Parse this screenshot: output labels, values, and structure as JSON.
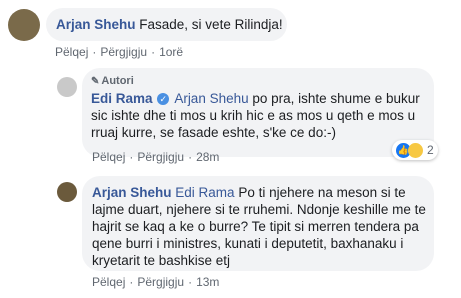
{
  "comment1": {
    "author": "Arjan Shehu",
    "text": "Fasade, si vete Rilindja!",
    "like": "Pëlqej",
    "reply": "Përgjigju",
    "time": "1orë"
  },
  "comment2": {
    "badge": "Autori",
    "author": "Edi Rama",
    "mention": "Arjan Shehu",
    "line1": " po pra, ishte shume e bukur",
    "line2": "sic ishte dhe ti mos u krih hic e as mos u qeth e mos u",
    "line3": "rruaj kurre, se fasade eshte, s'ke ce do:-)",
    "like": "Pëlqej",
    "reply": "Përgjigju",
    "time": "28m",
    "reaction_count": "2"
  },
  "comment3": {
    "author": "Arjan Shehu",
    "mention": "Edi Rama",
    "line1": " Po ti njehere na meson si te",
    "line2": "lajme duart, njehere si te rruhemi. Ndonje keshille me te",
    "line3": "hajrit se kaq a ke o burre? Te tipit si merren tendera pa",
    "line4": "qene burri i ministres, kunati i deputetit, baxhanaku i",
    "line5": "kryetarit te bashkise etj",
    "like": "Pëlqej",
    "reply": "Përgjigju",
    "time": "13m"
  },
  "colors": {
    "link": "#385898",
    "bubble": "#f2f3f5",
    "meta": "#606770"
  },
  "icons": {
    "badge": "pen-icon",
    "verified": "verified-icon",
    "reactions": [
      "like-icon",
      "haha-icon"
    ]
  }
}
